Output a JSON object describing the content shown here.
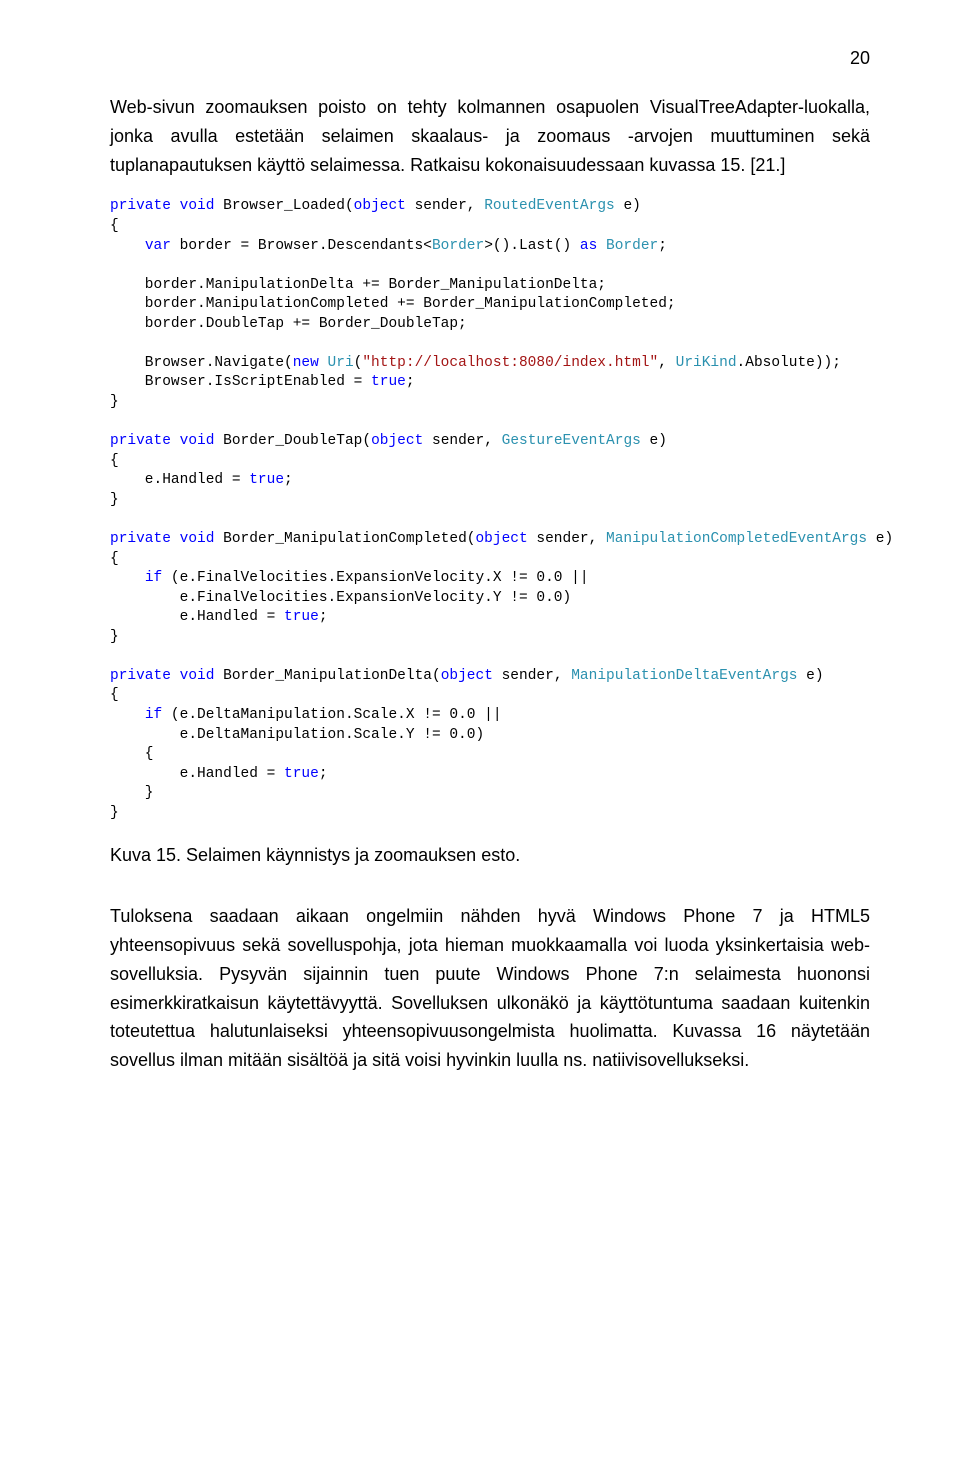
{
  "page_number": "20",
  "para1": "Web-sivun zoomauksen poisto on tehty kolmannen osapuolen VisualTreeAdapter-luokalla, jonka avulla estetään selaimen skaalaus- ja zoomaus -arvojen muuttuminen sekä tuplanapautuksen käyttö selaimessa. Ratkaisu kokonaisuudessaan kuvassa 15. [21.]",
  "caption": "Kuva 15. Selaimen käynnistys ja zoomauksen esto.",
  "para2": "Tuloksena saadaan aikaan ongelmiin nähden hyvä Windows Phone 7 ja HTML5 yhteensopivuus sekä sovelluspohja, jota hieman muokkaamalla voi luoda yksinkertaisia web-sovelluksia. Pysyvän sijainnin tuen puute Windows Phone 7:n selaimesta huononsi esimerkkiratkaisun käytettävyyttä. Sovelluksen ulkonäkö ja käyttötuntuma saadaan kuitenkin toteutettua halutunlaiseksi yhteensopivuusongelmista huolimatta. Kuvassa 16 näytetään sovellus ilman mitään sisältöä ja sitä voisi hyvinkin luulla ns. natiivisovellukseksi.",
  "code": {
    "m1_sig": {
      "kw1": "private",
      "kw2": "void",
      "name": "Browser_Loaded(",
      "kw3": "object",
      "p1": " sender, ",
      "type1": "RoutedEventArgs",
      "p2": " e)"
    },
    "m1_l1": {
      "kw1": "var",
      "txt1": " border = Browser.Descendants<",
      "type1": "Border",
      "txt2": ">().Last() ",
      "kw2": "as",
      "txt3": " ",
      "type2": "Border",
      "txt4": ";"
    },
    "m1_l2": "    border.ManipulationDelta += Border_ManipulationDelta;",
    "m1_l3": "    border.ManipulationCompleted += Border_ManipulationCompleted;",
    "m1_l4": "    border.DoubleTap += Border_DoubleTap;",
    "m1_l5": {
      "txt1": "    Browser.Navigate(",
      "kw1": "new",
      "txt2": " ",
      "type1": "Uri",
      "txt3": "(",
      "str1": "\"http://localhost:8080/index.html\"",
      "txt4": ", ",
      "type2": "UriKind",
      "txt5": ".Absolute));"
    },
    "m1_l6": {
      "txt1": "    Browser.IsScriptEnabled = ",
      "kw1": "true",
      "txt2": ";"
    },
    "m2_sig": {
      "kw1": "private",
      "kw2": "void",
      "name": "Border_DoubleTap(",
      "kw3": "object",
      "p1": " sender, ",
      "type1": "GestureEventArgs",
      "p2": " e)"
    },
    "m2_l1": {
      "txt1": "    e.Handled = ",
      "kw1": "true",
      "txt2": ";"
    },
    "m3_sig": {
      "kw1": "private",
      "kw2": "void",
      "name": "Border_ManipulationCompleted(",
      "kw3": "object",
      "p1": " sender, ",
      "type1": "ManipulationCompletedEventArgs",
      "p2": " e)"
    },
    "m3_l1": {
      "kw1": "if",
      "txt1": " (e.FinalVelocities.ExpansionVelocity.X != 0.0 ||"
    },
    "m3_l2": "        e.FinalVelocities.ExpansionVelocity.Y != 0.0)",
    "m3_l3": {
      "txt1": "        e.Handled = ",
      "kw1": "true",
      "txt2": ";"
    },
    "m4_sig": {
      "kw1": "private",
      "kw2": "void",
      "name": "Border_ManipulationDelta(",
      "kw3": "object",
      "p1": " sender, ",
      "type1": "ManipulationDeltaEventArgs",
      "p2": " e)"
    },
    "m4_l1": {
      "kw1": "if",
      "txt1": " (e.DeltaManipulation.Scale.X != 0.0 ||"
    },
    "m4_l2": "        e.DeltaManipulation.Scale.Y != 0.0)",
    "m4_l3": {
      "txt1": "        e.Handled = ",
      "kw1": "true",
      "txt2": ";"
    }
  }
}
